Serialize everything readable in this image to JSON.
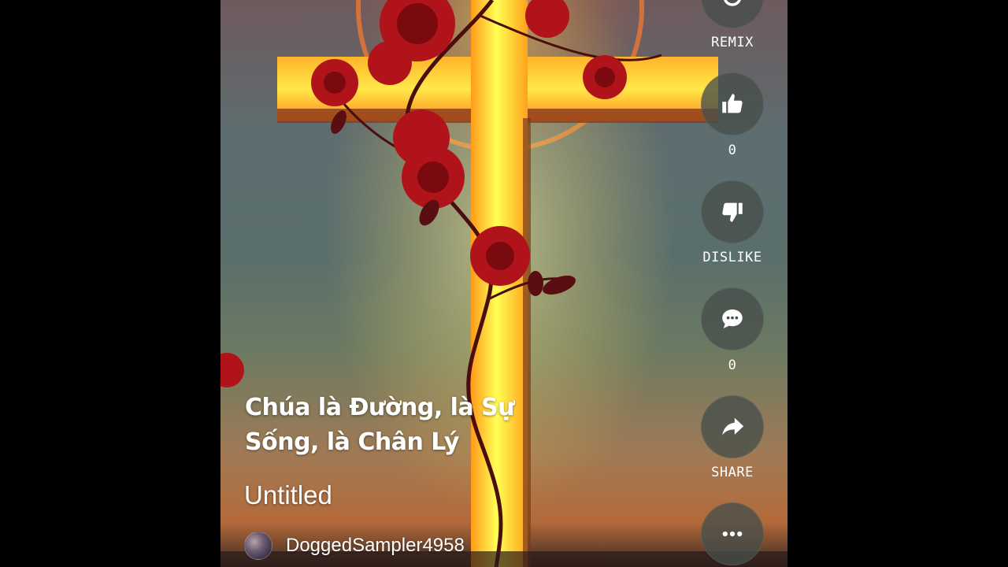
{
  "video": {
    "caption_line1": "Chúa là Đường, là Sự",
    "caption_line2": "Sống, là Chân Lý",
    "song_title": "Untitled",
    "author_name": "DoggedSampler4958"
  },
  "actions": {
    "remix_label": "REMIX",
    "like_count": "0",
    "dislike_label": "DISLIKE",
    "comment_count": "0",
    "share_label": "SHARE"
  },
  "icons": {
    "remix": "refresh-icon",
    "like": "thumbs-up-icon",
    "dislike": "thumbs-down-icon",
    "comment": "comment-bubble-icon",
    "share": "share-arrow-icon",
    "more": "more-dots-icon"
  },
  "colors": {
    "background": "#000000",
    "text": "#ffffff",
    "button_fill": "#464e4a"
  }
}
